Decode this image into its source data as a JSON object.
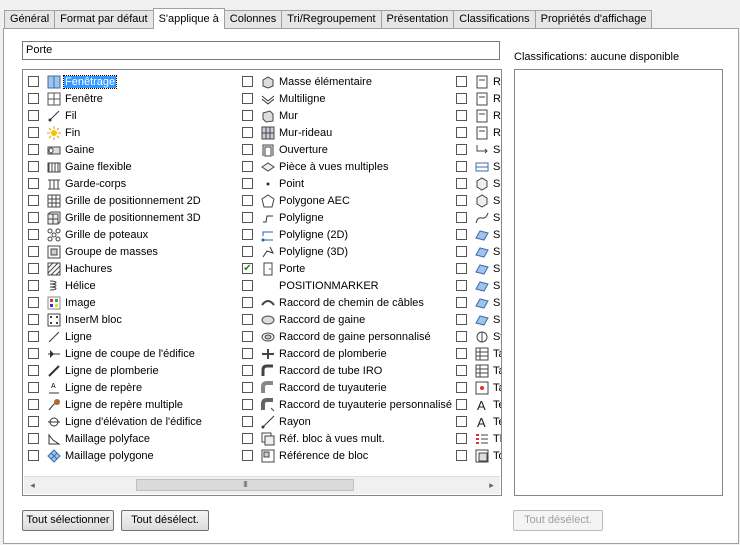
{
  "tabs": [
    {
      "label": "Général"
    },
    {
      "label": "Format par défaut"
    },
    {
      "label": "S'applique à",
      "active": true
    },
    {
      "label": "Colonnes"
    },
    {
      "label": "Tri/Regroupement"
    },
    {
      "label": "Présentation"
    },
    {
      "label": "Classifications"
    },
    {
      "label": "Propriétés d'affichage"
    }
  ],
  "filter_value": "Porte",
  "object_columns": [
    [
      {
        "label": "Fenêtrage",
        "icon": "window-assembly-icon",
        "checked": false,
        "selected": true
      },
      {
        "label": "Fenêtre",
        "icon": "window-icon",
        "checked": false
      },
      {
        "label": "Fil",
        "icon": "wire-icon",
        "checked": false
      },
      {
        "label": "Fin",
        "icon": "sun-icon",
        "checked": false
      },
      {
        "label": "Gaine",
        "icon": "duct-icon",
        "checked": false
      },
      {
        "label": "Gaine flexible",
        "icon": "flex-duct-icon",
        "checked": false
      },
      {
        "label": "Garde-corps",
        "icon": "railing-icon",
        "checked": false
      },
      {
        "label": "Grille de positionnement 2D",
        "icon": "layout-grid-2d-icon",
        "checked": false
      },
      {
        "label": "Grille de positionnement 3D",
        "icon": "layout-grid-3d-icon",
        "checked": false
      },
      {
        "label": "Grille de poteaux",
        "icon": "column-grid-icon",
        "checked": false
      },
      {
        "label": "Groupe de masses",
        "icon": "mass-group-icon",
        "checked": false
      },
      {
        "label": "Hachures",
        "icon": "hatch-icon",
        "checked": false
      },
      {
        "label": "Hélice",
        "icon": "helix-icon",
        "checked": false
      },
      {
        "label": "Image",
        "icon": "image-icon",
        "checked": false
      },
      {
        "label": "InserM bloc",
        "icon": "minsert-block-icon",
        "checked": false
      },
      {
        "label": "Ligne",
        "icon": "line-icon",
        "checked": false
      },
      {
        "label": "Ligne de coupe de l'édifice",
        "icon": "section-line-icon",
        "checked": false
      },
      {
        "label": "Ligne de plomberie",
        "icon": "plumbing-line-icon",
        "checked": false
      },
      {
        "label": "Ligne de repère",
        "icon": "leader-icon",
        "checked": false
      },
      {
        "label": "Ligne de repère multiple",
        "icon": "multileader-icon",
        "checked": false
      },
      {
        "label": "Ligne d'élévation de l'édifice",
        "icon": "elevation-line-icon",
        "checked": false
      },
      {
        "label": "Maillage polyface",
        "icon": "polyface-mesh-icon",
        "checked": false
      },
      {
        "label": "Maillage polygone",
        "icon": "polygon-mesh-icon",
        "checked": false
      }
    ],
    [
      {
        "label": "Masse élémentaire",
        "icon": "mass-element-icon",
        "checked": false
      },
      {
        "label": "Multiligne",
        "icon": "multiline-icon",
        "checked": false
      },
      {
        "label": "Mur",
        "icon": "wall-icon",
        "checked": false
      },
      {
        "label": "Mur-rideau",
        "icon": "curtain-wall-icon",
        "checked": false
      },
      {
        "label": "Ouverture",
        "icon": "opening-icon",
        "checked": false
      },
      {
        "label": "Pièce à vues multiples",
        "icon": "multi-view-part-icon",
        "checked": false
      },
      {
        "label": "Point",
        "icon": "point-icon",
        "checked": false
      },
      {
        "label": "Polygone AEC",
        "icon": "aec-polygon-icon",
        "checked": false
      },
      {
        "label": "Polyligne",
        "icon": "polyline-icon",
        "checked": false
      },
      {
        "label": "Polyligne (2D)",
        "icon": "polyline-2d-icon",
        "checked": false
      },
      {
        "label": "Polyligne (3D)",
        "icon": "polyline-3d-icon",
        "checked": false
      },
      {
        "label": "Porte",
        "icon": "door-icon",
        "checked": true
      },
      {
        "label": "POSITIONMARKER",
        "icon": "",
        "checked": false
      },
      {
        "label": "Raccord de chemin de câbles",
        "icon": "cable-tray-fitting-icon",
        "checked": false
      },
      {
        "label": "Raccord de gaine",
        "icon": "duct-fitting-icon",
        "checked": false
      },
      {
        "label": "Raccord de gaine personnalisé",
        "icon": "custom-duct-fitting-icon",
        "checked": false
      },
      {
        "label": "Raccord de plomberie",
        "icon": "plumbing-fitting-icon",
        "checked": false
      },
      {
        "label": "Raccord de tube IRO",
        "icon": "conduit-fitting-icon",
        "checked": false
      },
      {
        "label": "Raccord de tuyauterie",
        "icon": "pipe-fitting-icon",
        "checked": false
      },
      {
        "label": "Raccord de tuyauterie personnalisé",
        "icon": "custom-pipe-fitting-icon",
        "checked": false
      },
      {
        "label": "Rayon",
        "icon": "ray-icon",
        "checked": false
      },
      {
        "label": "Réf. bloc à vues mult.",
        "icon": "multi-view-block-ref-icon",
        "checked": false
      },
      {
        "label": "Référence de bloc",
        "icon": "block-reference-icon",
        "checked": false
      }
    ],
    [
      {
        "label": "Ré",
        "icon": "ref-icon",
        "checked": false
      },
      {
        "label": "Ré",
        "icon": "ref-icon",
        "checked": false
      },
      {
        "label": "Ré",
        "icon": "ref-icon",
        "checked": false
      },
      {
        "label": "Ré",
        "icon": "ref-icon",
        "checked": false
      },
      {
        "label": "Sc",
        "icon": "schedule-icon",
        "checked": false
      },
      {
        "label": "Se",
        "icon": "section-icon",
        "checked": false
      },
      {
        "label": "So",
        "icon": "solid-icon",
        "checked": false
      },
      {
        "label": "So",
        "icon": "solid-icon",
        "checked": false
      },
      {
        "label": "Sp",
        "icon": "spline-icon",
        "checked": false
      },
      {
        "label": "Su",
        "icon": "surface-icon",
        "checked": false
      },
      {
        "label": "Su",
        "icon": "surface-icon",
        "checked": false
      },
      {
        "label": "Su",
        "icon": "surface-icon",
        "checked": false
      },
      {
        "label": "Su",
        "icon": "surface-icon",
        "checked": false
      },
      {
        "label": "Su",
        "icon": "surface-icon",
        "checked": false
      },
      {
        "label": "Su",
        "icon": "surface-icon",
        "checked": false
      },
      {
        "label": "Sy",
        "icon": "symbol-icon",
        "checked": false
      },
      {
        "label": "Ta",
        "icon": "table-icon",
        "checked": false
      },
      {
        "label": "Ta",
        "icon": "table-icon",
        "checked": false
      },
      {
        "label": "Ta",
        "icon": "tag-icon",
        "checked": false
      },
      {
        "label": "Te",
        "icon": "text-icon",
        "checked": false
      },
      {
        "label": "Te",
        "icon": "text-icon",
        "checked": false
      },
      {
        "label": "Th",
        "icon": "thumbnail-icon",
        "checked": false
      },
      {
        "label": "To",
        "icon": "tolerance-icon",
        "checked": false
      }
    ]
  ],
  "classifications_label": "Classifications: aucune disponible",
  "buttons": {
    "select_all": "Tout sélectionner",
    "deselect_all": "Tout désélect.",
    "classif_deselect_all": "Tout désélect."
  },
  "scrollbar": {
    "left_arrow": "◂",
    "right_arrow": "▸",
    "grip": "III"
  },
  "colors": {
    "selection": "#3399ff",
    "check": "#1a8c1a"
  }
}
